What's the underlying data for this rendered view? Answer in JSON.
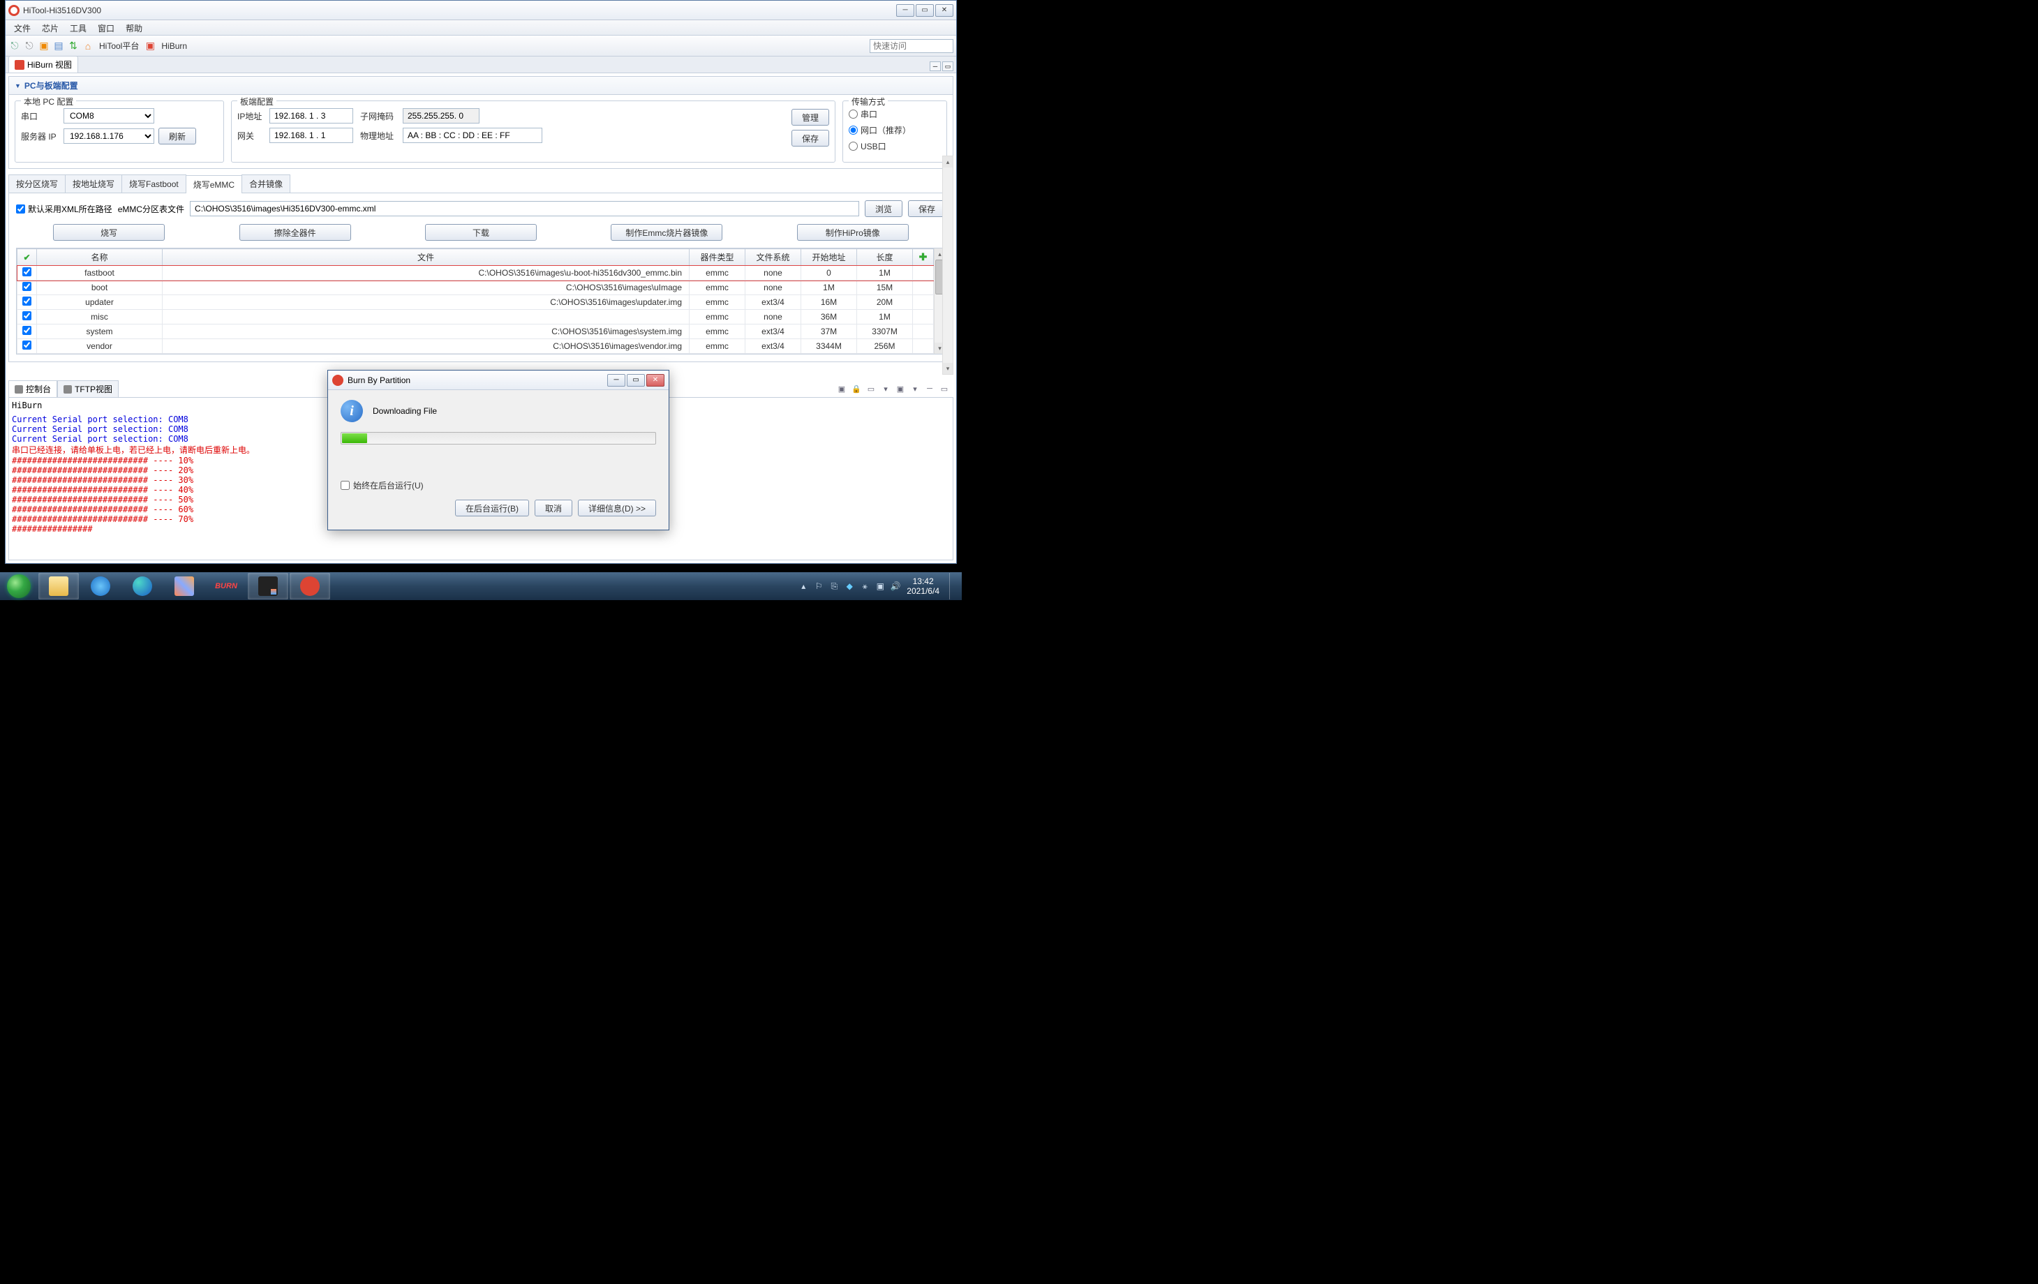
{
  "window": {
    "title": "HiTool-Hi3516DV300"
  },
  "menu": {
    "items": [
      "文件",
      "芯片",
      "工具",
      "窗口",
      "帮助"
    ]
  },
  "toolbar": {
    "hitool_platform": "HiTool平台",
    "hiburn": "HiBurn",
    "quick_access_placeholder": "快速访问"
  },
  "view_tab": {
    "label": "HiBurn 视图"
  },
  "section": {
    "title": "PC与板端配置"
  },
  "local_pc": {
    "legend": "本地 PC 配置",
    "serial_label": "串口",
    "serial_value": "COM8",
    "server_ip_label": "服务器 IP",
    "server_ip_value": "192.168.1.176",
    "refresh": "刷新"
  },
  "board": {
    "legend": "板端配置",
    "ip_label": "IP地址",
    "ip_value": "192.168. 1 . 3",
    "gateway_label": "网关",
    "gateway_value": "192.168. 1 . 1",
    "subnet_label": "子网掩码",
    "subnet_value": "255.255.255. 0",
    "mac_label": "物理地址",
    "mac_value": "AA : BB : CC : DD : EE : FF",
    "manage": "管理",
    "save": "保存"
  },
  "transfer": {
    "legend": "传输方式",
    "serial": "串口",
    "net": "网口（推荐）",
    "usb": "USB口"
  },
  "tabs": {
    "t1": "按分区烧写",
    "t2": "按地址烧写",
    "t3": "烧写Fastboot",
    "t4": "烧写eMMC",
    "t5": "合并镜像"
  },
  "xml": {
    "default_label": "默认采用XML所在路径",
    "file_label": "eMMC分区表文件",
    "path": "C:\\OHOS\\3516\\images\\Hi3516DV300-emmc.xml",
    "browse": "浏览",
    "save": "保存"
  },
  "actions": {
    "burn": "烧写",
    "erase": "擦除全器件",
    "download": "下载",
    "make_emmc": "制作Emmc烧片器镜像",
    "make_hipro": "制作HiPro镜像"
  },
  "table": {
    "headers": {
      "name": "名称",
      "file": "文件",
      "device": "器件类型",
      "fs": "文件系统",
      "start": "开始地址",
      "length": "长度"
    },
    "rows": [
      {
        "checked": true,
        "name": "fastboot",
        "file": "C:\\OHOS\\3516\\images\\u-boot-hi3516dv300_emmc.bin",
        "device": "emmc",
        "fs": "none",
        "start": "0",
        "length": "1M"
      },
      {
        "checked": true,
        "name": "boot",
        "file": "C:\\OHOS\\3516\\images\\uImage",
        "device": "emmc",
        "fs": "none",
        "start": "1M",
        "length": "15M"
      },
      {
        "checked": true,
        "name": "updater",
        "file": "C:\\OHOS\\3516\\images\\updater.img",
        "device": "emmc",
        "fs": "ext3/4",
        "start": "16M",
        "length": "20M"
      },
      {
        "checked": true,
        "name": "misc",
        "file": "",
        "device": "emmc",
        "fs": "none",
        "start": "36M",
        "length": "1M"
      },
      {
        "checked": true,
        "name": "system",
        "file": "C:\\OHOS\\3516\\images\\system.img",
        "device": "emmc",
        "fs": "ext3/4",
        "start": "37M",
        "length": "3307M"
      },
      {
        "checked": true,
        "name": "vendor",
        "file": "C:\\OHOS\\3516\\images\\vendor.img",
        "device": "emmc",
        "fs": "ext3/4",
        "start": "3344M",
        "length": "256M"
      }
    ]
  },
  "console": {
    "tab1": "控制台",
    "tab2": "TFTP视图",
    "header": "HiBurn",
    "lines": [
      {
        "cls": "c-blue",
        "text": "Current Serial port selection: COM8"
      },
      {
        "cls": "c-blue",
        "text": "Current Serial port selection: COM8"
      },
      {
        "cls": "c-blue",
        "text": "Current Serial port selection: COM8"
      },
      {
        "cls": "c-blue",
        "text": ""
      },
      {
        "cls": "c-red",
        "text": "串口已经连接，请给单板上电，若已经上电，请断电后重新上电。"
      },
      {
        "cls": "c-red",
        "text": "########################### ---- 10%"
      },
      {
        "cls": "c-red",
        "text": "########################### ---- 20%"
      },
      {
        "cls": "c-red",
        "text": "########################### ---- 30%"
      },
      {
        "cls": "c-red",
        "text": "########################### ---- 40%"
      },
      {
        "cls": "c-red",
        "text": "########################### ---- 50%"
      },
      {
        "cls": "c-red",
        "text": "########################### ---- 60%"
      },
      {
        "cls": "c-red",
        "text": "########################### ---- 70%"
      },
      {
        "cls": "c-red",
        "text": "################"
      }
    ]
  },
  "dialog": {
    "title": "Burn By Partition",
    "message": "Downloading File",
    "always_bg": "始终在后台运行(U)",
    "run_bg": "在后台运行(B)",
    "cancel": "取消",
    "details": "详细信息(D) >>"
  },
  "tray": {
    "time": "13:42",
    "date": "2021/6/4"
  }
}
